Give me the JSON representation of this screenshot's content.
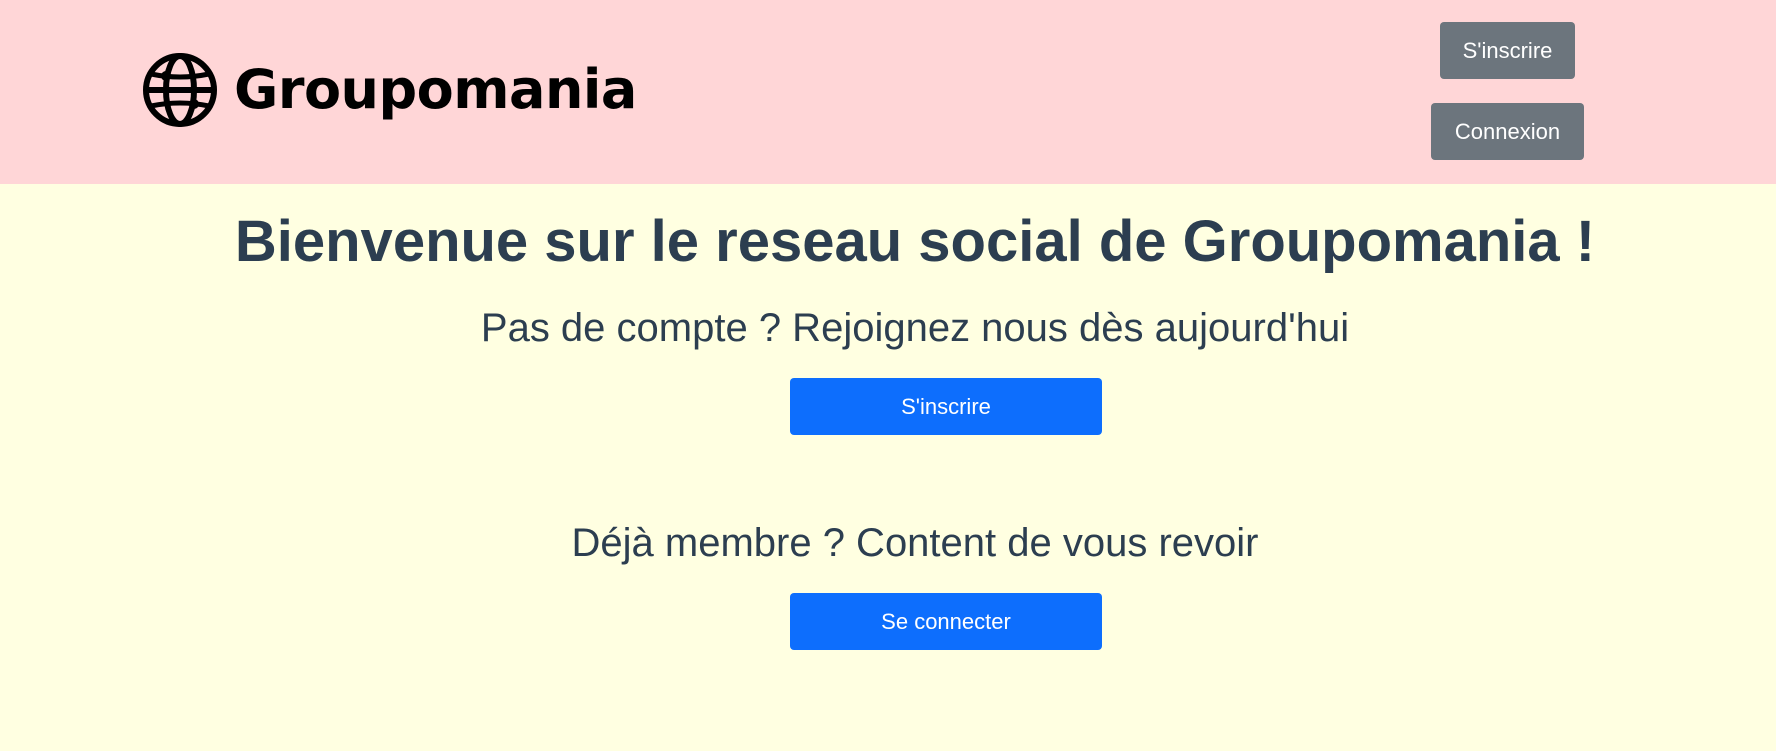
{
  "header": {
    "brand_name": "Groupomania",
    "logo_icon": "globe-icon",
    "nav": {
      "signup_label": "S'inscrire",
      "login_label": "Connexion"
    }
  },
  "main": {
    "welcome_title": "Bienvenue sur le reseau social de Groupomania !",
    "signup_prompt": "Pas de compte ? Rejoignez nous dès aujourd'hui",
    "signup_button": "S'inscrire",
    "login_prompt": "Déjà membre ? Content de vous revoir",
    "login_button": "Se connecter"
  },
  "colors": {
    "header_background": "#FFD6D7",
    "page_background": "#FFFFE1",
    "nav_button": "#6C757D",
    "primary_button": "#0D6EFD",
    "heading_text": "#2C3E50"
  }
}
